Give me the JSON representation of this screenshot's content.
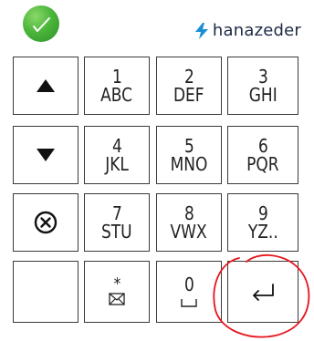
{
  "header": {
    "status_icon": "checkmark-circle-icon",
    "status_color": "#4cb63b",
    "brand_name": "hanazeder",
    "brand_icon": "lightning-bolt-icon",
    "brand_color": "#1d2a44",
    "accent_color": "#1a8fd6"
  },
  "keypad": {
    "arrow_up_icon": "triangle-up-icon",
    "arrow_down_icon": "triangle-down-icon",
    "cancel_icon": "circle-x-icon",
    "enter_icon": "enter-return-icon",
    "key_1": {
      "digit": "1",
      "letters": "ABC"
    },
    "key_2": {
      "digit": "2",
      "letters": "DEF"
    },
    "key_3": {
      "digit": "3",
      "letters": "GHI"
    },
    "key_4": {
      "digit": "4",
      "letters": "JKL"
    },
    "key_5": {
      "digit": "5",
      "letters": "MNO"
    },
    "key_6": {
      "digit": "6",
      "letters": "PQR"
    },
    "key_7": {
      "digit": "7",
      "letters": "STU"
    },
    "key_8": {
      "digit": "8",
      "letters": "VWX"
    },
    "key_9": {
      "digit": "9",
      "letters": "YZ.."
    },
    "key_star": {
      "symbol": "*",
      "icon": "envelope-icon"
    },
    "key_0": {
      "digit": "0",
      "icon": "space-icon"
    }
  },
  "annotation": {
    "shape": "red-circle",
    "color": "#e8141c",
    "target": "enter-key"
  }
}
